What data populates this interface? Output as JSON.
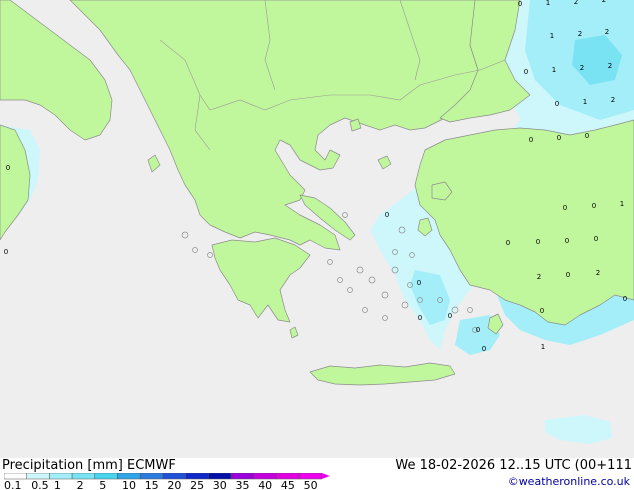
{
  "footer": {
    "title": "Precipitation [mm]  ECMWF",
    "datetime": "We 18-02-2026 12..15 UTC (00+111",
    "credit": "©weatheronline.co.uk"
  },
  "legend": {
    "ticks": [
      "0.1",
      "0.5",
      "1",
      "2",
      "5",
      "10",
      "15",
      "20",
      "25",
      "30",
      "35",
      "40",
      "45",
      "50"
    ],
    "colors": [
      "#ffffff",
      "#cdf7fb",
      "#a3eef8",
      "#79e3f4",
      "#48d3ef",
      "#2fa4e6",
      "#2a7ae0",
      "#2050d8",
      "#0f28c8",
      "#0010a8",
      "#9a00dc",
      "#c500dc",
      "#e100e1",
      "#ee00ee"
    ]
  },
  "map": {
    "colors": {
      "sea": "#eeeeee",
      "land": "#c1f79c",
      "precip_light": "#cdf7fb",
      "precip_medium": "#a3eef8",
      "precip_heavy": "#79e3f4"
    },
    "point_values": [
      "0",
      "1",
      "2",
      "2",
      "1",
      "2",
      "2",
      "0",
      "1",
      "2",
      "2",
      "0",
      "1",
      "2",
      "0",
      "0",
      "0",
      "0",
      "0",
      "0",
      "1",
      "0",
      "0",
      "0",
      "0",
      "0",
      "2",
      "0",
      "2",
      "0",
      "0",
      "0",
      "0",
      "0",
      "0",
      "1",
      "0",
      "0"
    ]
  }
}
